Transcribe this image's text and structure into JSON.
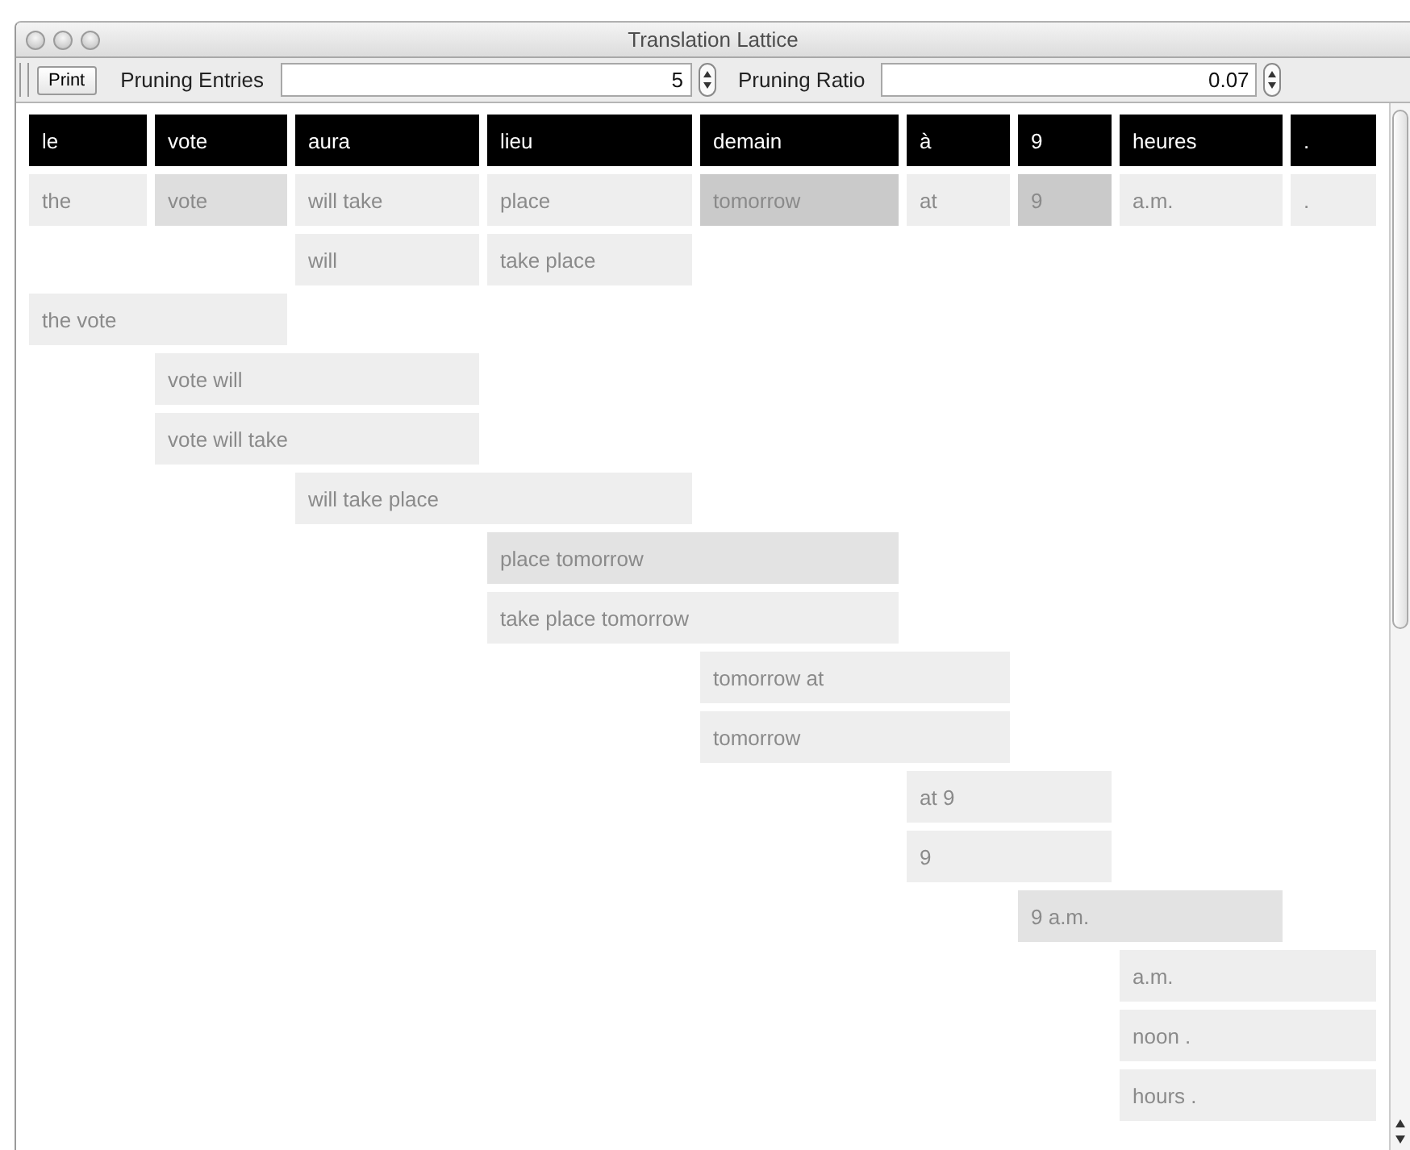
{
  "window": {
    "title": "Translation Lattice"
  },
  "toolbar": {
    "print_button": "Print",
    "fields": [
      {
        "label": "Pruning Entries",
        "value": "5"
      },
      {
        "label": "Pruning Ratio",
        "value": "0.07"
      }
    ]
  },
  "lattice": {
    "headers": [
      "le",
      "vote",
      "aura",
      "lieu",
      "demain",
      "à",
      "9",
      "heures",
      "."
    ],
    "rows": [
      {
        "cells": [
          {
            "kind": "phrase",
            "text": "the",
            "color": "#eeeeee"
          },
          {
            "kind": "phrase",
            "text": "vote",
            "color": "#dedede"
          },
          {
            "kind": "phrase",
            "text": "will take",
            "color": "#eeeeee"
          },
          {
            "kind": "phrase",
            "text": "place",
            "color": "#eeeeee"
          },
          {
            "kind": "phrase",
            "text": "tomorrow",
            "color": "#cacaca"
          },
          {
            "kind": "phrase",
            "text": "at",
            "color": "#eeeeee"
          },
          {
            "kind": "phrase",
            "text": "9",
            "color": "#cacaca"
          },
          {
            "kind": "phrase",
            "text": "a.m.",
            "color": "#eeeeee"
          },
          {
            "kind": "phrase",
            "text": ".",
            "color": "#eeeeee"
          }
        ]
      },
      {
        "cells": [
          {
            "kind": "empty"
          },
          {
            "kind": "empty"
          },
          {
            "kind": "phrase",
            "text": "will",
            "color": "#eeeeee"
          },
          {
            "kind": "phrase",
            "text": "take place",
            "color": "#eeeeee"
          }
        ]
      },
      {
        "cells": [
          {
            "kind": "phrase",
            "text": "the vote",
            "color": "#eeeeee"
          },
          {
            "kind": "continued"
          }
        ]
      },
      {
        "cells": [
          {
            "kind": "empty"
          },
          {
            "kind": "phrase",
            "text": "vote will",
            "color": "#eeeeee"
          },
          {
            "kind": "continued"
          }
        ]
      },
      {
        "cells": [
          {
            "kind": "empty"
          },
          {
            "kind": "phrase",
            "text": "vote will take",
            "color": "#eeeeee"
          },
          {
            "kind": "continued"
          }
        ]
      },
      {
        "cells": [
          {
            "kind": "empty"
          },
          {
            "kind": "empty"
          },
          {
            "kind": "phrase",
            "text": "will take place",
            "color": "#eeeeee"
          },
          {
            "kind": "continued"
          }
        ]
      },
      {
        "cells": [
          {
            "kind": "empty"
          },
          {
            "kind": "empty"
          },
          {
            "kind": "empty"
          },
          {
            "kind": "phrase",
            "text": "place tomorrow",
            "color": "#e3e3e3"
          },
          {
            "kind": "continued"
          }
        ]
      },
      {
        "cells": [
          {
            "kind": "empty"
          },
          {
            "kind": "empty"
          },
          {
            "kind": "empty"
          },
          {
            "kind": "phrase",
            "text": "take place tomorrow",
            "color": "#eeeeee"
          },
          {
            "kind": "continued"
          }
        ]
      },
      {
        "cells": [
          {
            "kind": "empty"
          },
          {
            "kind": "empty"
          },
          {
            "kind": "empty"
          },
          {
            "kind": "empty"
          },
          {
            "kind": "phrase",
            "text": "tomorrow at",
            "color": "#eeeeee"
          },
          {
            "kind": "continued"
          }
        ]
      },
      {
        "cells": [
          {
            "kind": "empty"
          },
          {
            "kind": "empty"
          },
          {
            "kind": "empty"
          },
          {
            "kind": "empty"
          },
          {
            "kind": "phrase",
            "text": "tomorrow",
            "color": "#eeeeee"
          },
          {
            "kind": "continued"
          }
        ]
      },
      {
        "cells": [
          {
            "kind": "empty"
          },
          {
            "kind": "empty"
          },
          {
            "kind": "empty"
          },
          {
            "kind": "empty"
          },
          {
            "kind": "empty"
          },
          {
            "kind": "phrase",
            "text": "at 9",
            "color": "#eeeeee"
          },
          {
            "kind": "continued"
          }
        ]
      },
      {
        "cells": [
          {
            "kind": "empty"
          },
          {
            "kind": "empty"
          },
          {
            "kind": "empty"
          },
          {
            "kind": "empty"
          },
          {
            "kind": "empty"
          },
          {
            "kind": "phrase",
            "text": "9",
            "color": "#eeeeee"
          },
          {
            "kind": "continued"
          }
        ]
      },
      {
        "cells": [
          {
            "kind": "empty"
          },
          {
            "kind": "empty"
          },
          {
            "kind": "empty"
          },
          {
            "kind": "empty"
          },
          {
            "kind": "empty"
          },
          {
            "kind": "empty"
          },
          {
            "kind": "phrase",
            "text": "9 a.m.",
            "color": "#e3e3e3"
          },
          {
            "kind": "continued"
          }
        ]
      },
      {
        "cells": [
          {
            "kind": "empty"
          },
          {
            "kind": "empty"
          },
          {
            "kind": "empty"
          },
          {
            "kind": "empty"
          },
          {
            "kind": "empty"
          },
          {
            "kind": "empty"
          },
          {
            "kind": "empty"
          },
          {
            "kind": "phrase",
            "text": "a.m.",
            "color": "#eeeeee"
          },
          {
            "kind": "continued"
          }
        ]
      },
      {
        "cells": [
          {
            "kind": "empty"
          },
          {
            "kind": "empty"
          },
          {
            "kind": "empty"
          },
          {
            "kind": "empty"
          },
          {
            "kind": "empty"
          },
          {
            "kind": "empty"
          },
          {
            "kind": "empty"
          },
          {
            "kind": "phrase",
            "text": "noon .",
            "color": "#eeeeee"
          },
          {
            "kind": "continued"
          }
        ]
      },
      {
        "cells": [
          {
            "kind": "empty"
          },
          {
            "kind": "empty"
          },
          {
            "kind": "empty"
          },
          {
            "kind": "empty"
          },
          {
            "kind": "empty"
          },
          {
            "kind": "empty"
          },
          {
            "kind": "empty"
          },
          {
            "kind": "phrase",
            "text": "hours .",
            "color": "#eeeeee"
          },
          {
            "kind": "continued"
          }
        ]
      }
    ]
  }
}
